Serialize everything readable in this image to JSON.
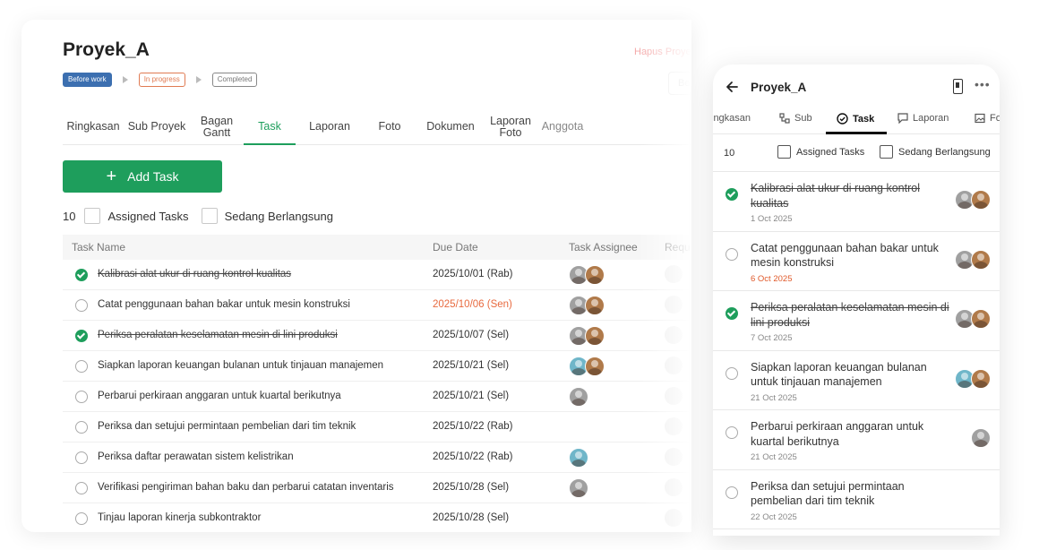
{
  "desktop": {
    "title": "Proyek_A",
    "delete_label": "Hapus Proyek",
    "stage_button": "Be",
    "stages": [
      "Before work",
      "In progress",
      "Completed"
    ],
    "tabs": [
      {
        "label": "Ringkasan",
        "w": 68
      },
      {
        "label": "Sub Proyek",
        "w": 74
      },
      {
        "label": "Bagan Gantt",
        "w": 60
      },
      {
        "label": "Task",
        "w": 58
      },
      {
        "label": "Laporan",
        "w": 76
      },
      {
        "label": "Foto",
        "w": 58
      },
      {
        "label": "Dokumen",
        "w": 78
      },
      {
        "label": "Laporan Foto",
        "w": 56
      },
      {
        "label": "Anggota",
        "w": 60
      }
    ],
    "add_task_label": "Add Task",
    "task_count": "10",
    "filter_assigned": "Assigned Tasks",
    "filter_ongoing": "Sedang Berlangsung",
    "columns": {
      "name": "Task Name",
      "due": "Due Date",
      "assignee": "Task Assignee",
      "requester": "Requ"
    },
    "tasks": [
      {
        "name": "Kalibrasi alat ukur di ruang kontrol kualitas",
        "due": "2025/10/01 (Rab)",
        "done": true,
        "late": false,
        "avatars": [
          "g",
          "b"
        ]
      },
      {
        "name": "Catat penggunaan bahan bakar untuk mesin konstruksi",
        "due": "2025/10/06 (Sen)",
        "done": false,
        "late": true,
        "avatars": [
          "g",
          "b"
        ]
      },
      {
        "name": "Periksa peralatan keselamatan mesin di lini produksi",
        "due": "2025/10/07 (Sel)",
        "done": true,
        "late": false,
        "avatars": [
          "g",
          "b"
        ]
      },
      {
        "name": "Siapkan laporan keuangan bulanan untuk tinjauan manajemen",
        "due": "2025/10/21 (Sel)",
        "done": false,
        "late": false,
        "avatars": [
          "t",
          "b"
        ]
      },
      {
        "name": "Perbarui perkiraan anggaran untuk kuartal berikutnya",
        "due": "2025/10/21 (Sel)",
        "done": false,
        "late": false,
        "avatars": [
          "g"
        ]
      },
      {
        "name": "Periksa dan setujui permintaan pembelian dari tim teknik",
        "due": "2025/10/22 (Rab)",
        "done": false,
        "late": false,
        "avatars": []
      },
      {
        "name": "Periksa daftar perawatan sistem kelistrikan",
        "due": "2025/10/22 (Rab)",
        "done": false,
        "late": false,
        "avatars": [
          "t"
        ]
      },
      {
        "name": "Verifikasi pengiriman bahan baku dan perbarui catatan inventaris",
        "due": "2025/10/28 (Sel)",
        "done": false,
        "late": false,
        "avatars": [
          "g"
        ]
      },
      {
        "name": "Tinjau laporan kinerja subkontraktor",
        "due": "2025/10/28 (Sel)",
        "done": false,
        "late": false,
        "avatars": []
      }
    ]
  },
  "mobile": {
    "title": "Proyek_A",
    "more": "•••",
    "tabs": [
      "ingkasan",
      "Sub",
      "Task",
      "Laporan",
      "Fo"
    ],
    "task_count": "10",
    "filter_assigned": "Assigned Tasks",
    "filter_ongoing": "Sedang Berlangsung",
    "tasks": [
      {
        "name": "Kalibrasi alat ukur di ruang kontrol kualitas",
        "date": "1 Oct 2025",
        "done": true,
        "late": false,
        "avatars": [
          "g",
          "b"
        ]
      },
      {
        "name": "Catat penggunaan bahan bakar untuk mesin konstruksi",
        "date": "6 Oct 2025",
        "done": false,
        "late": true,
        "avatars": [
          "g",
          "b"
        ]
      },
      {
        "name": "Periksa peralatan keselamatan mesin di lini produksi",
        "date": "7 Oct 2025",
        "done": true,
        "late": false,
        "avatars": [
          "g",
          "b"
        ]
      },
      {
        "name": "Siapkan laporan keuangan bulanan untuk tinjauan manajemen",
        "date": "21 Oct 2025",
        "done": false,
        "late": false,
        "avatars": [
          "t",
          "b"
        ]
      },
      {
        "name": "Perbarui perkiraan anggaran untuk kuartal berikutnya",
        "date": "21 Oct 2025",
        "done": false,
        "late": false,
        "avatars": [
          "g"
        ]
      },
      {
        "name": "Periksa dan setujui permintaan pembelian dari tim teknik",
        "date": "22 Oct 2025",
        "done": false,
        "late": false,
        "avatars": []
      }
    ]
  },
  "colors": {
    "primary": "#1e9e5c",
    "late": "#e86a3f",
    "before_work": "#3c6fb0",
    "in_progress": "#e07b53"
  }
}
